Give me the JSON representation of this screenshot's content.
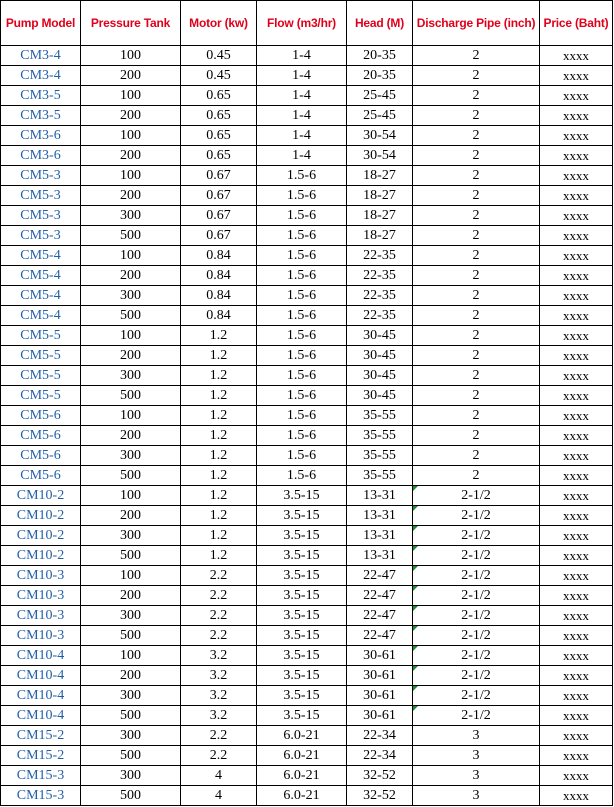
{
  "headers": [
    "Pump Model",
    "Pressure Tank",
    "Motor (kw)",
    "Flow (m3/hr)",
    "Head (M)",
    "Discharge Pipe (inch)",
    "Price (Baht)"
  ],
  "colors": {
    "header_text": "#e0001b",
    "model_text": "#1f5fa8",
    "flag_marker": "#1c8a2e"
  },
  "rows": [
    [
      "CM3-4",
      "100",
      "0.45",
      "1-4",
      "20-35",
      "2",
      "xxxx"
    ],
    [
      "CM3-4",
      "200",
      "0.45",
      "1-4",
      "20-35",
      "2",
      "xxxx"
    ],
    [
      "CM3-5",
      "100",
      "0.65",
      "1-4",
      "25-45",
      "2",
      "xxxx"
    ],
    [
      "CM3-5",
      "200",
      "0.65",
      "1-4",
      "25-45",
      "2",
      "xxxx"
    ],
    [
      "CM3-6",
      "100",
      "0.65",
      "1-4",
      "30-54",
      "2",
      "xxxx"
    ],
    [
      "CM3-6",
      "200",
      "0.65",
      "1-4",
      "30-54",
      "2",
      "xxxx"
    ],
    [
      "CM5-3",
      "100",
      "0.67",
      "1.5-6",
      "18-27",
      "2",
      "xxxx"
    ],
    [
      "CM5-3",
      "200",
      "0.67",
      "1.5-6",
      "18-27",
      "2",
      "xxxx"
    ],
    [
      "CM5-3",
      "300",
      "0.67",
      "1.5-6",
      "18-27",
      "2",
      "xxxx"
    ],
    [
      "CM5-3",
      "500",
      "0.67",
      "1.5-6",
      "18-27",
      "2",
      "xxxx"
    ],
    [
      "CM5-4",
      "100",
      "0.84",
      "1.5-6",
      "22-35",
      "2",
      "xxxx"
    ],
    [
      "CM5-4",
      "200",
      "0.84",
      "1.5-6",
      "22-35",
      "2",
      "xxxx"
    ],
    [
      "CM5-4",
      "300",
      "0.84",
      "1.5-6",
      "22-35",
      "2",
      "xxxx"
    ],
    [
      "CM5-4",
      "500",
      "0.84",
      "1.5-6",
      "22-35",
      "2",
      "xxxx"
    ],
    [
      "CM5-5",
      "100",
      "1.2",
      "1.5-6",
      "30-45",
      "2",
      "xxxx"
    ],
    [
      "CM5-5",
      "200",
      "1.2",
      "1.5-6",
      "30-45",
      "2",
      "xxxx"
    ],
    [
      "CM5-5",
      "300",
      "1.2",
      "1.5-6",
      "30-45",
      "2",
      "xxxx"
    ],
    [
      "CM5-5",
      "500",
      "1.2",
      "1.5-6",
      "30-45",
      "2",
      "xxxx"
    ],
    [
      "CM5-6",
      "100",
      "1.2",
      "1.5-6",
      "35-55",
      "2",
      "xxxx"
    ],
    [
      "CM5-6",
      "200",
      "1.2",
      "1.5-6",
      "35-55",
      "2",
      "xxxx"
    ],
    [
      "CM5-6",
      "300",
      "1.2",
      "1.5-6",
      "35-55",
      "2",
      "xxxx"
    ],
    [
      "CM5-6",
      "500",
      "1.2",
      "1.5-6",
      "35-55",
      "2",
      "xxxx"
    ],
    [
      "CM10-2",
      "100",
      "1.2",
      "3.5-15",
      "13-31",
      "2-1/2",
      "xxxx"
    ],
    [
      "CM10-2",
      "200",
      "1.2",
      "3.5-15",
      "13-31",
      "2-1/2",
      "xxxx"
    ],
    [
      "CM10-2",
      "300",
      "1.2",
      "3.5-15",
      "13-31",
      "2-1/2",
      "xxxx"
    ],
    [
      "CM10-2",
      "500",
      "1.2",
      "3.5-15",
      "13-31",
      "2-1/2",
      "xxxx"
    ],
    [
      "CM10-3",
      "100",
      "2.2",
      "3.5-15",
      "22-47",
      "2-1/2",
      "xxxx"
    ],
    [
      "CM10-3",
      "200",
      "2.2",
      "3.5-15",
      "22-47",
      "2-1/2",
      "xxxx"
    ],
    [
      "CM10-3",
      "300",
      "2.2",
      "3.5-15",
      "22-47",
      "2-1/2",
      "xxxx"
    ],
    [
      "CM10-3",
      "500",
      "2.2",
      "3.5-15",
      "22-47",
      "2-1/2",
      "xxxx"
    ],
    [
      "CM10-4",
      "100",
      "3.2",
      "3.5-15",
      "30-61",
      "2-1/2",
      "xxxx"
    ],
    [
      "CM10-4",
      "200",
      "3.2",
      "3.5-15",
      "30-61",
      "2-1/2",
      "xxxx"
    ],
    [
      "CM10-4",
      "300",
      "3.2",
      "3.5-15",
      "30-61",
      "2-1/2",
      "xxxx"
    ],
    [
      "CM10-4",
      "500",
      "3.2",
      "3.5-15",
      "30-61",
      "2-1/2",
      "xxxx"
    ],
    [
      "CM15-2",
      "300",
      "2.2",
      "6.0-21",
      "22-34",
      "3",
      "xxxx"
    ],
    [
      "CM15-2",
      "500",
      "2.2",
      "6.0-21",
      "22-34",
      "3",
      "xxxx"
    ],
    [
      "CM15-3",
      "300",
      "4",
      "6.0-21",
      "32-52",
      "3",
      "xxxx"
    ],
    [
      "CM15-3",
      "500",
      "4",
      "6.0-21",
      "32-52",
      "3",
      "xxxx"
    ]
  ]
}
